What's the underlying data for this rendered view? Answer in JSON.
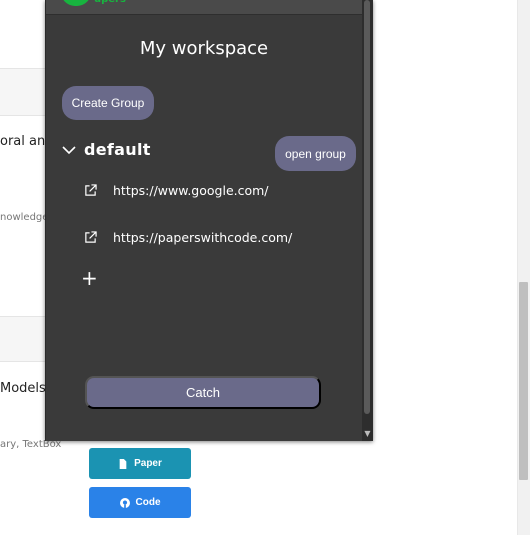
{
  "background_page": {
    "items": [
      {
        "title_fragment": "oral and",
        "meta_fragment": "nowledge"
      },
      {
        "title_fragment": "Models",
        "meta_fragment": "ary, TextBox"
      }
    ],
    "paper_label": "Paper",
    "code_label": "Code"
  },
  "popup": {
    "logo_text": "upers",
    "title": "My workspace",
    "create_group_label": "Create Group",
    "open_group_label": "open group",
    "group": {
      "name": "default",
      "links": [
        "https://www.google.com/",
        "https://paperswithcode.com/"
      ]
    },
    "add_label": "+",
    "catch_label": "Catch"
  },
  "colors": {
    "popup_bg": "#3a3a3a",
    "button_bg": "#6a6a8a",
    "paper_button": "#1b93b2",
    "code_button": "#2a82e8",
    "logo_green": "#17b43f"
  }
}
